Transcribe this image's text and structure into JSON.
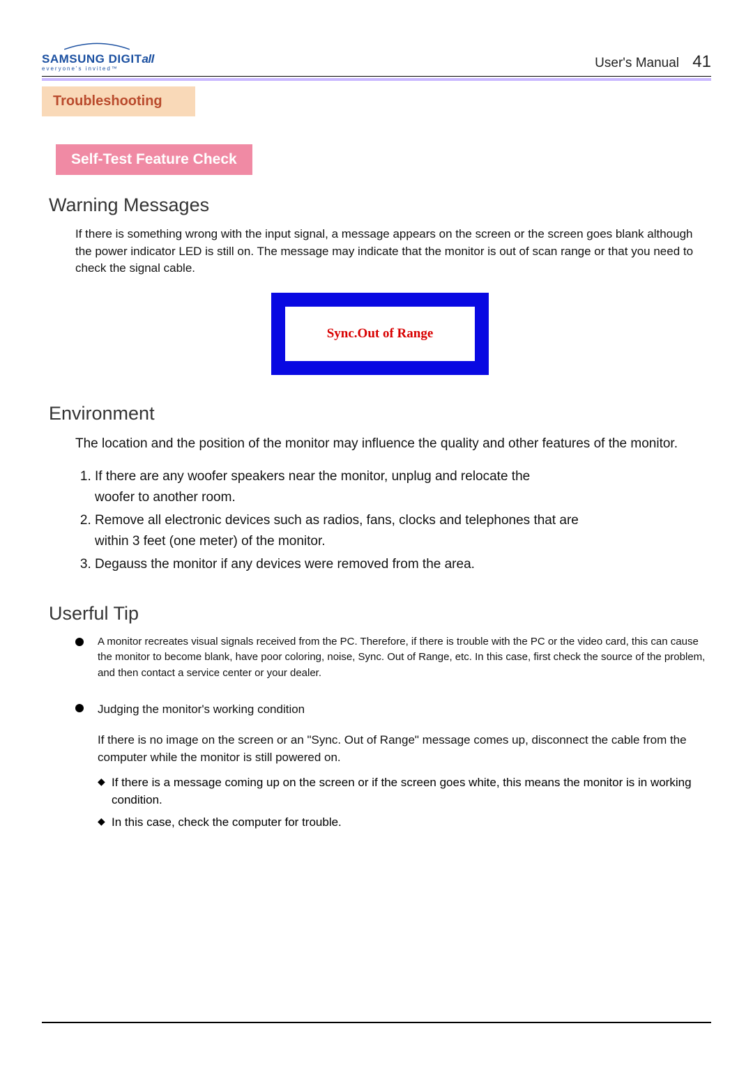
{
  "logo": {
    "brand_a": "SAMSUNG ",
    "brand_b": "DIGIT",
    "brand_c": "all",
    "tagline": "everyone's invited™"
  },
  "header": {
    "title": "User's  Manual",
    "page": "41"
  },
  "section_tab": "Troubleshooting",
  "sub_tab": "Self-Test Feature Check",
  "warning": {
    "heading": "Warning Messages",
    "body": "If there is something wrong with the input signal, a message appears on the screen or the screen goes blank although the power indicator LED is still on. The message may indicate that the monitor is out of scan range or that you need to check the signal cable.",
    "box_text": "Sync.Out of Range"
  },
  "environment": {
    "heading": "Environment",
    "intro": "The location and the position of the monitor may influence the quality and other features of the monitor.",
    "items": [
      "If there are any woofer speakers near the monitor, unplug and relocate the woofer to another room.",
      "Remove all electronic devices such as radios, fans, clocks and telephones that are within 3 feet (one meter) of the monitor.",
      "Degauss the monitor if any devices were removed from the area."
    ]
  },
  "tip": {
    "heading": "Userful Tip",
    "tip1": "A monitor recreates visual signals received from the PC. Therefore, if there is trouble with the PC or the video card, this can cause the monitor to become blank, have poor coloring, noise, Sync. Out of Range, etc. In this case, first check the source of the problem, and then contact a service center or your dealer.",
    "tip2_title": "Judging the monitor's working condition",
    "tip2_body": "If there is no image on the screen or an \"Sync. Out of Range\" message comes up, disconnect the cable from the computer while the monitor is still powered on.",
    "tip2_d1": "If there is a message coming up on the screen or if the screen goes white, this means the monitor is in working condition.",
    "tip2_d2": "In this case, check the computer for trouble."
  }
}
